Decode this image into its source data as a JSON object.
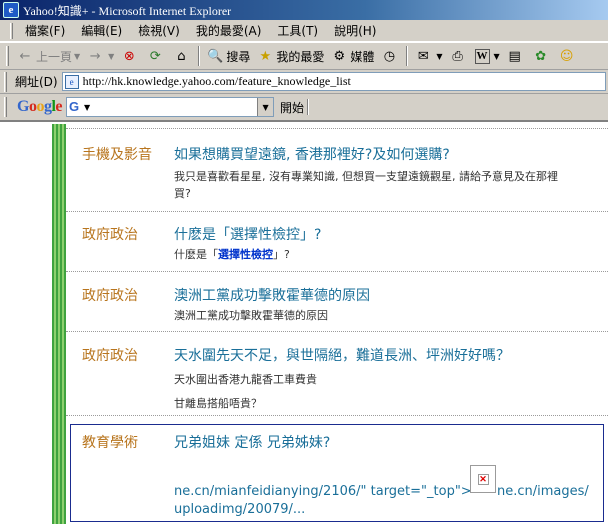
{
  "window": {
    "title": "Yahoo!知識+ - Microsoft Internet Explorer",
    "app_icon": "ie-icon"
  },
  "menu": {
    "items": [
      "檔案(F)",
      "編輯(E)",
      "檢視(V)",
      "我的最愛(A)",
      "工具(T)",
      "說明(H)"
    ]
  },
  "toolbar": {
    "back_label": "上一頁",
    "search_label": "搜尋",
    "favorites_label": "我的最愛",
    "media_label": "媒體"
  },
  "address": {
    "label": "網址(D)",
    "url": "http://hk.knowledge.yahoo.com/feature_knowledge_list"
  },
  "google": {
    "logo": "Google",
    "go_label": "開始"
  },
  "questions": [
    {
      "category": "手機及影音",
      "title": "如果想購買望遠鏡, 香港那裡好?及如何選購?",
      "desc_lines": [
        "我只是喜歡看星星, 沒有專業知識, 但想買一支望遠鏡觀星, 請給予意見及在那裡",
        "買?"
      ]
    },
    {
      "category": "政府政治",
      "title": "什麽是「選擇性檢控」?",
      "desc_pre": "什麽是「",
      "desc_bold": "選擇性檢控",
      "desc_post": "」?"
    },
    {
      "category": "政府政治",
      "title": "澳洲工黨成功擊敗霍華德的原因",
      "desc_lines": [
        "澳洲工黨成功擊敗霍華德的原因"
      ]
    },
    {
      "category": "政府政治",
      "title": "天水圍先天不足，與世隔絕，難道長洲、坪洲好好嗎？",
      "desc_lines": [
        "天水圍出香港九龍香工車費貴",
        "甘離島搭船唔貴？"
      ]
    },
    {
      "category": "教育學術",
      "title": "兄弟姐妹 定係 兄弟姊妹?",
      "link_line1_left": "ne.cn/mianfeidianying/2106/\" target=\"_top\">",
      "link_line1_right": "ne.cn/images/",
      "link_line2": "uploadimg/20079/..."
    }
  ]
}
